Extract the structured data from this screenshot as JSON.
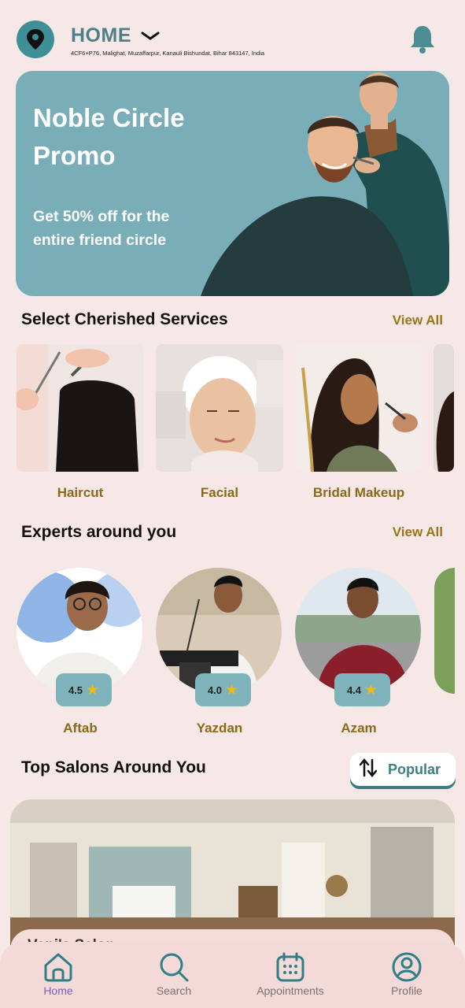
{
  "header": {
    "title": "HOME",
    "address": "4CF6+P76, Malighat, Muzaffarpur, Kanauli Bishundat, Bihar 843147, India"
  },
  "banner": {
    "title": "Noble Circle Promo",
    "subtitle": "Get 50% off for the entire friend circle"
  },
  "services": {
    "heading": "Select Cherished Services",
    "view_all": "View All",
    "items": [
      {
        "label": "Haircut"
      },
      {
        "label": "Facial"
      },
      {
        "label": "Bridal Makeup"
      }
    ]
  },
  "experts": {
    "heading": "Experts around you",
    "view_all": "View All",
    "items": [
      {
        "name": "Aftab",
        "rating": "4.5"
      },
      {
        "name": "Yazdan",
        "rating": "4.0"
      },
      {
        "name": "Azam",
        "rating": "4.4"
      }
    ]
  },
  "salons": {
    "heading": "Top Salons Around You",
    "sort_label": "Popular",
    "first_card_name": "Vani's Salon"
  },
  "nav": {
    "items": [
      {
        "label": "Home",
        "icon": "home-icon",
        "active": true
      },
      {
        "label": "Search",
        "icon": "search-icon",
        "active": false
      },
      {
        "label": "Appointments",
        "icon": "calendar-icon",
        "active": false
      },
      {
        "label": "Profile",
        "icon": "profile-icon",
        "active": false
      }
    ]
  },
  "colors": {
    "accent": "#3e8f96",
    "banner_bg": "#79aeb8",
    "gold_text": "#8a6a1a",
    "page_bg": "#f6e8e6",
    "nav_active": "#7a63b3"
  }
}
